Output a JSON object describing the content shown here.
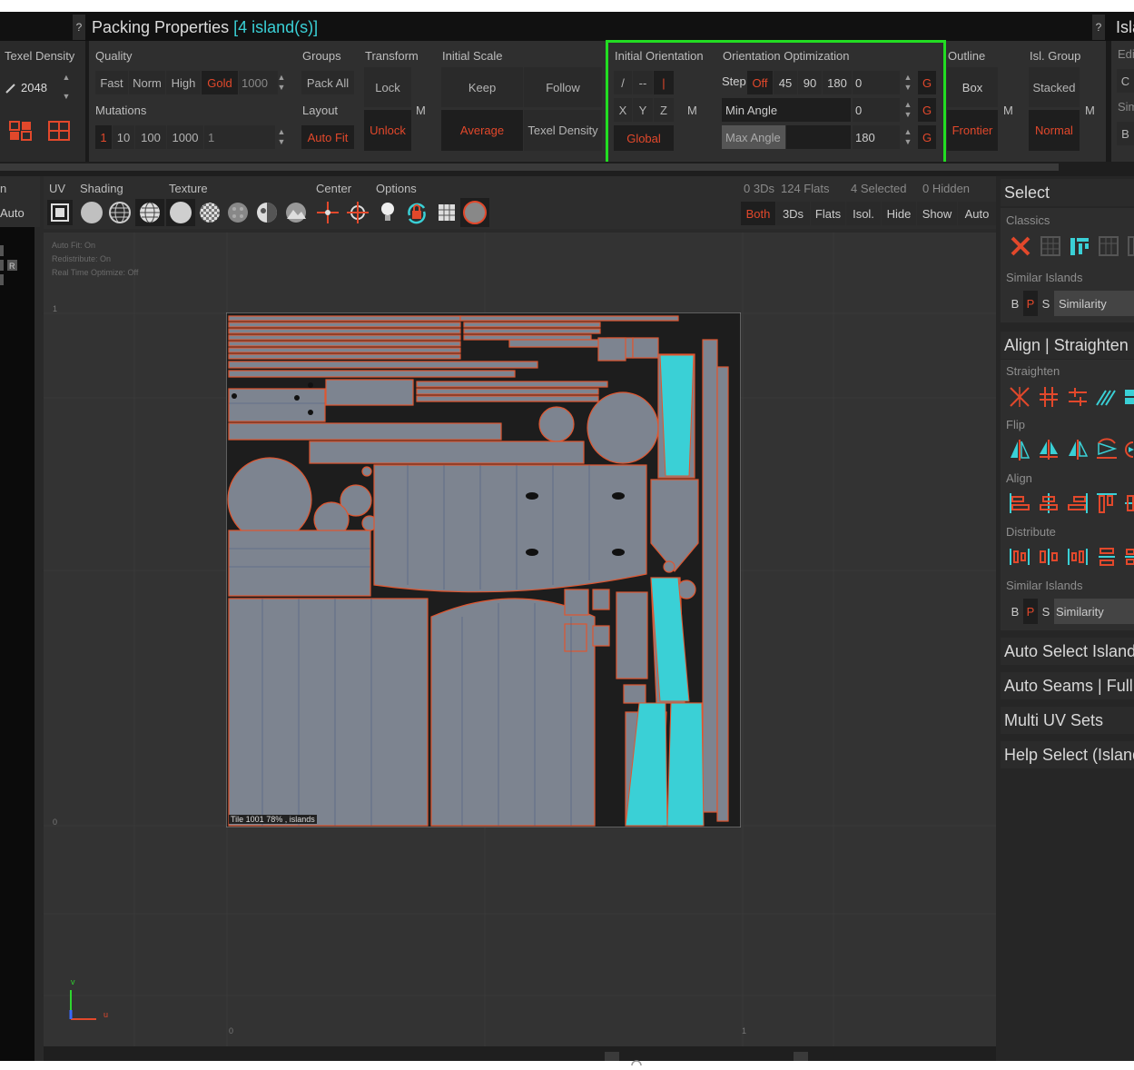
{
  "window": {
    "title": "Packing Properties",
    "island_count": "[4 island(s)]",
    "help": "?",
    "right_title": "Isla"
  },
  "left_panel": {
    "texel_density_label": "Texel Density",
    "texel_value": "2048",
    "auto_label": "Auto",
    "n_label": "n"
  },
  "quality": {
    "label": "Quality",
    "options": [
      "Fast",
      "Norm",
      "High",
      "Gold"
    ],
    "selected": "Gold",
    "value": "1000"
  },
  "mutations": {
    "label": "Mutations",
    "options": [
      "1",
      "10",
      "100",
      "1000"
    ],
    "value": "1"
  },
  "groups": {
    "label": "Groups",
    "pack_all": "Pack All"
  },
  "layout": {
    "label": "Layout",
    "auto_fit": "Auto Fit"
  },
  "transform": {
    "label": "Transform",
    "lock": "Lock",
    "unlock": "Unlock",
    "m": "M"
  },
  "initial_scale": {
    "label": "Initial Scale",
    "keep": "Keep",
    "follow": "Follow",
    "average": "Average",
    "texel_density": "Texel Density"
  },
  "initial_orientation": {
    "label": "Initial Orientation",
    "row1": [
      "/",
      "--",
      "|"
    ],
    "row2": [
      "X",
      "Y",
      "Z"
    ],
    "m": "M",
    "global": "Global"
  },
  "orientation_optimization": {
    "label": "Orientation Optimization",
    "step_label": "Step",
    "step_options": [
      "Off",
      "45",
      "90",
      "180",
      "0"
    ],
    "min_angle_label": "Min Angle",
    "min_angle_value": "0",
    "max_angle_label": "Max Angle",
    "max_angle_value": "180",
    "g": "G"
  },
  "outline": {
    "label": "Outline",
    "box": "Box",
    "frontier": "Frontier",
    "m": "M"
  },
  "isl_group": {
    "label": "Isl. Group",
    "stacked": "Stacked",
    "normal": "Normal",
    "m": "M"
  },
  "far_right": {
    "edit": "Edi",
    "c": "C",
    "sim": "Sim",
    "b": "B"
  },
  "viewport_toolbar": {
    "uv": "UV",
    "shading": "Shading",
    "texture": "Texture",
    "center": "Center",
    "options": "Options",
    "stats": {
      "threeds": "0 3Ds",
      "flats": "124 Flats",
      "selected": "4 Selected",
      "hidden": "0 Hidden"
    },
    "filters": [
      "Both",
      "3Ds",
      "Flats",
      "Isol.",
      "Hide",
      "Show",
      "Auto"
    ]
  },
  "viewport": {
    "info": [
      "Auto Fit: On",
      "Redistribute: On",
      "Real Time Optimize: Off"
    ],
    "tile_label": "Tile 1001 78% , islands",
    "axis_top": "1",
    "axis_zero_v": "0",
    "axis_zero_u": "0",
    "axis_one_u": "1",
    "axis_v": "v",
    "axis_u": "u"
  },
  "right_panel": {
    "select": "Select",
    "classics": "Classics",
    "similar_islands": "Similar Islands",
    "bps": [
      "B",
      "P",
      "S"
    ],
    "similarity": "Similarity",
    "align_straighten": "Align | Straighten |",
    "straighten": "Straighten",
    "flip": "Flip",
    "align": "Align",
    "distribute": "Distribute",
    "similar_islands2": "Similar Islands",
    "auto_select": "Auto Select Island",
    "auto_seams": "Auto Seams | Full",
    "multi_uv": "Multi UV Sets",
    "help_select": "Help Select (Island"
  },
  "colors": {
    "accent_red": "#e2482b",
    "accent_cyan": "#3ad0d6",
    "highlight_green": "#22dd22",
    "bg_dark": "#2a2a2a"
  }
}
